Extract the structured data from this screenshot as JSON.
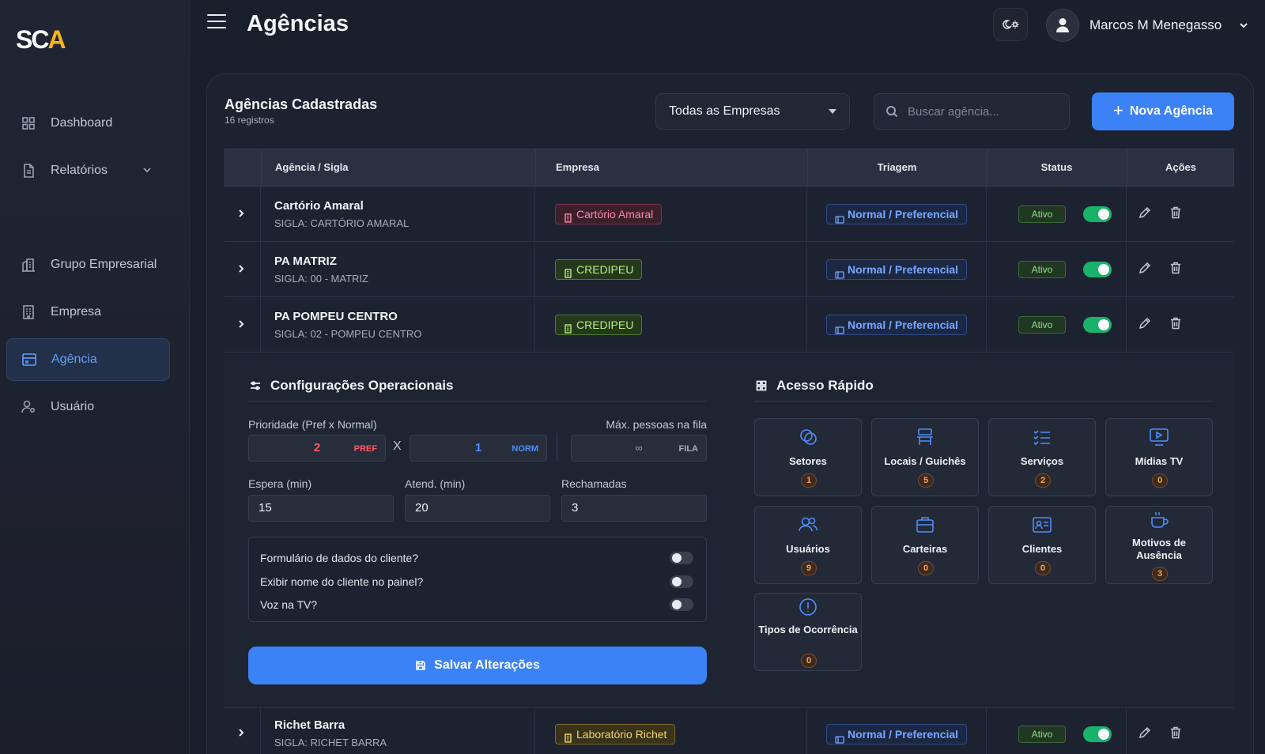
{
  "app": {
    "logo_main": "SC",
    "logo_accent": "A"
  },
  "sidebar": {
    "items": [
      {
        "label": "Dashboard",
        "icon": "grid-icon"
      },
      {
        "label": "Relatórios",
        "icon": "document-icon"
      },
      {
        "label": "Grupo Empresarial",
        "icon": "buildings-icon"
      },
      {
        "label": "Empresa",
        "icon": "building-icon"
      },
      {
        "label": "Agência",
        "icon": "store-icon"
      },
      {
        "label": "Usuário",
        "icon": "user-gear-icon"
      }
    ]
  },
  "header": {
    "title": "Agências",
    "user_name": "Marcos M Menegasso"
  },
  "main": {
    "title": "Agências Cadastradas",
    "subtitle": "16 registros",
    "company_filter": "Todas as Empresas",
    "search_placeholder": "Buscar agência...",
    "new_button": "Nova Agência",
    "new_button_plus": "+",
    "columns": [
      "Agência / Sigla",
      "Empresa",
      "Triagem",
      "Status",
      "Ações"
    ],
    "rows": [
      {
        "name": "Cartório Amaral",
        "sigla": "SIGLA: CARTÓRIO AMARAL",
        "empresa": "Cartório Amaral",
        "empresa_color": "pink",
        "triagem": "Normal / Preferencial",
        "status": "Ativo",
        "active": true
      },
      {
        "name": "PA MATRIZ",
        "sigla": "SIGLA: 00 - MATRIZ",
        "empresa": "CREDIPEU",
        "empresa_color": "green",
        "triagem": "Normal / Preferencial",
        "status": "Ativo",
        "active": true
      },
      {
        "name": "PA POMPEU CENTRO",
        "sigla": "SIGLA: 02 - POMPEU CENTRO",
        "empresa": "CREDIPEU",
        "empresa_color": "green",
        "triagem": "Normal / Preferencial",
        "status": "Ativo",
        "active": true
      },
      {
        "name": "Richet Barra",
        "sigla": "SIGLA: RICHET BARRA",
        "empresa": "Laboratório Richet",
        "empresa_color": "yellow",
        "triagem": "Normal / Preferencial",
        "status": "Ativo",
        "active": true
      }
    ]
  },
  "config": {
    "title": "Configurações Operacionais",
    "priority_label": "Prioridade (Pref x Normal)",
    "pref_value": "2",
    "pref_suffix": "PREF",
    "x_sep": "X",
    "norm_value": "1",
    "norm_suffix": "NORM",
    "max_label": "Máx. pessoas na fila",
    "max_value": "∞",
    "max_suffix": "FILA",
    "espera_label": "Espera (min)",
    "espera_value": "15",
    "atend_label": "Atend. (min)",
    "atend_value": "20",
    "rech_label": "Rechamadas",
    "rech_value": "3",
    "options": [
      {
        "label": "Formulário de dados do cliente?",
        "on": false
      },
      {
        "label": "Exibir nome do cliente no painel?",
        "on": false
      },
      {
        "label": "Voz na TV?",
        "on": false
      }
    ],
    "save_button": "Salvar Alterações"
  },
  "quick": {
    "title": "Acesso Rápido",
    "items": [
      {
        "label": "Setores",
        "count": "1",
        "icon": "sectors-icon"
      },
      {
        "label": "Locais / Guichês",
        "count": "5",
        "icon": "desk-icon"
      },
      {
        "label": "Serviços",
        "count": "2",
        "icon": "checklist-icon"
      },
      {
        "label": "Mídias TV",
        "count": "0",
        "icon": "tv-play-icon"
      },
      {
        "label": "Usuários",
        "count": "9",
        "icon": "users-icon"
      },
      {
        "label": "Carteiras",
        "count": "0",
        "icon": "briefcase-icon"
      },
      {
        "label": "Clientes",
        "count": "0",
        "icon": "id-card-icon"
      },
      {
        "label": "Motivos de Ausência",
        "count": "3",
        "icon": "coffee-icon"
      },
      {
        "label": "Tipos de Ocorrência",
        "count": "0",
        "icon": "alert-circle-icon"
      }
    ]
  },
  "colors": {
    "accent": "#3b82f6",
    "success": "#19b26b",
    "background": "#1a1f2c"
  }
}
